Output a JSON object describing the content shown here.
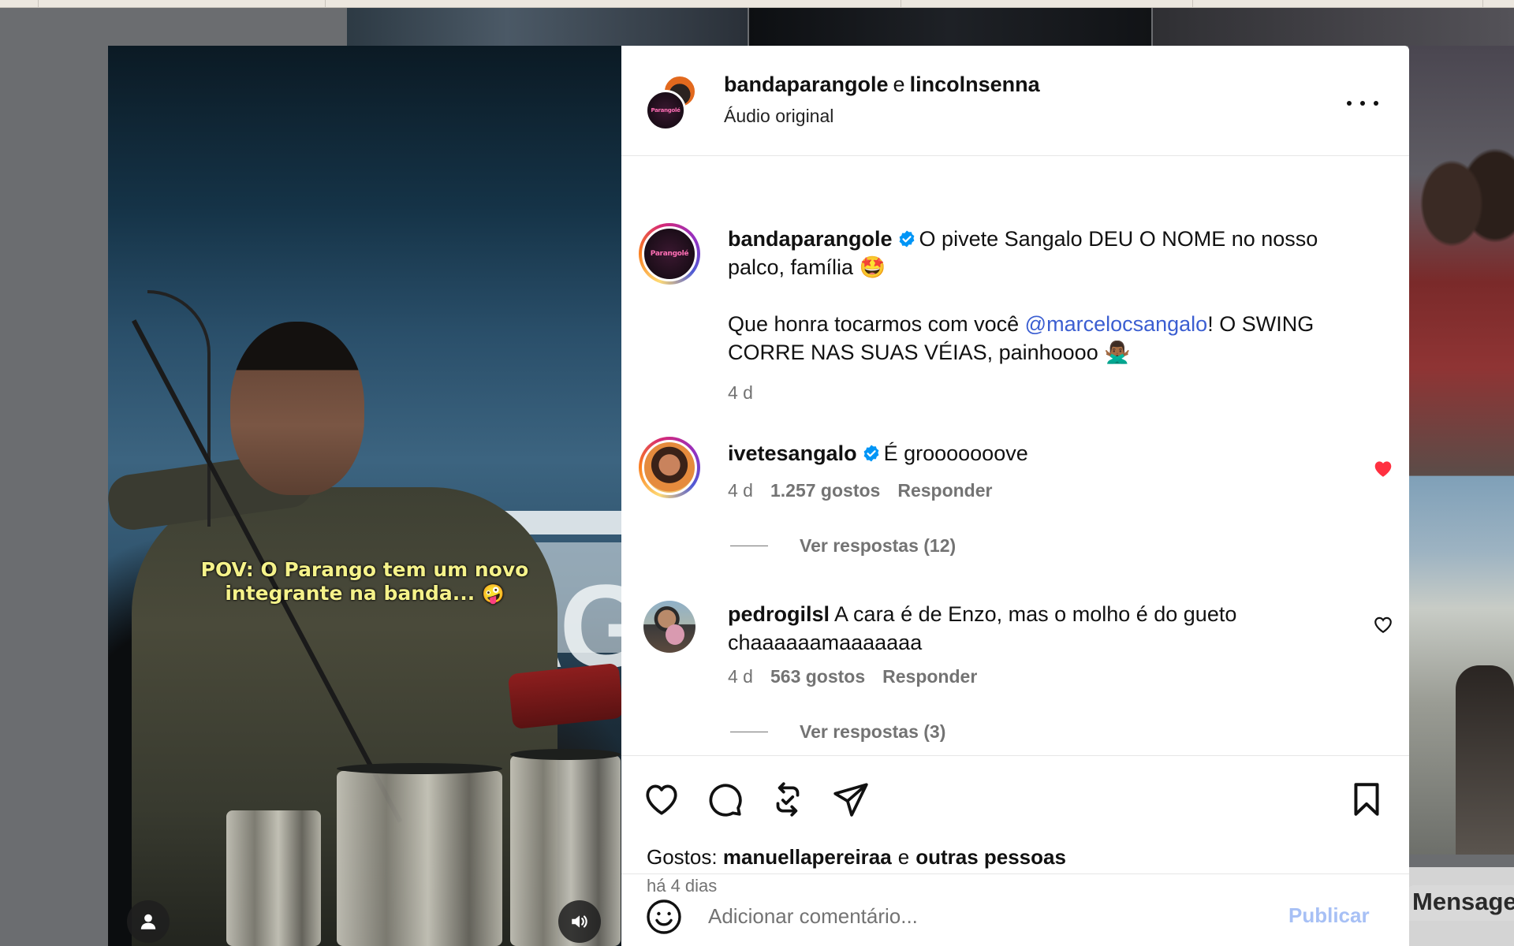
{
  "post": {
    "author": "bandaparangole",
    "coauthor_joiner": "e",
    "coauthor": "lincolnsenna",
    "audio": "Áudio original",
    "avatar_text": "Parangolé",
    "caption_user": "bandaparangole",
    "caption_line1": "O pivete Sangalo DEU O NOME no nosso palco, família 🤩",
    "caption_line2_before": "Que honra tocarmos com você ",
    "caption_mention": "@marcelocsangalo",
    "caption_line2_after": "! O SWING CORRE NAS SUAS VÉIAS, painhoooo 🙅🏾‍♂️",
    "caption_time": "4 d"
  },
  "video": {
    "overlay_line1": "POV: O Parango tem um novo",
    "overlay_line2": "integrante na banda...",
    "overlay_emoji": "🤪",
    "user_icon": "person-icon",
    "volume_icon": "volume-icon"
  },
  "comments": [
    {
      "user": "ivetesangalo",
      "verified": true,
      "text": "É grooooooove",
      "time": "4 d",
      "likes": "1.257 gostos",
      "reply": "Responder",
      "replies": "Ver respostas (12)",
      "liked": true
    },
    {
      "user": "pedrogilsl",
      "verified": false,
      "text": "A cara é de Enzo, mas o molho é do gueto chaaaaaamaaaaaaa",
      "time": "4 d",
      "likes": "563 gostos",
      "reply": "Responder",
      "replies": "Ver respostas (3)",
      "liked": false
    }
  ],
  "actions": {
    "likes_prefix": "Gostos:",
    "liker": "manuellapereiraa",
    "likes_joiner": "e",
    "likes_others": "outras pessoas",
    "date": "há 4 dias"
  },
  "composer": {
    "placeholder": "Adicionar comentário...",
    "publish": "Publicar"
  },
  "background": {
    "message_label": "Mensage"
  },
  "colors": {
    "accent_link": "#3b5ed1",
    "like_red": "#ff3040",
    "verified_blue": "#0095f6",
    "publish_disabled": "#a7c0f5"
  }
}
